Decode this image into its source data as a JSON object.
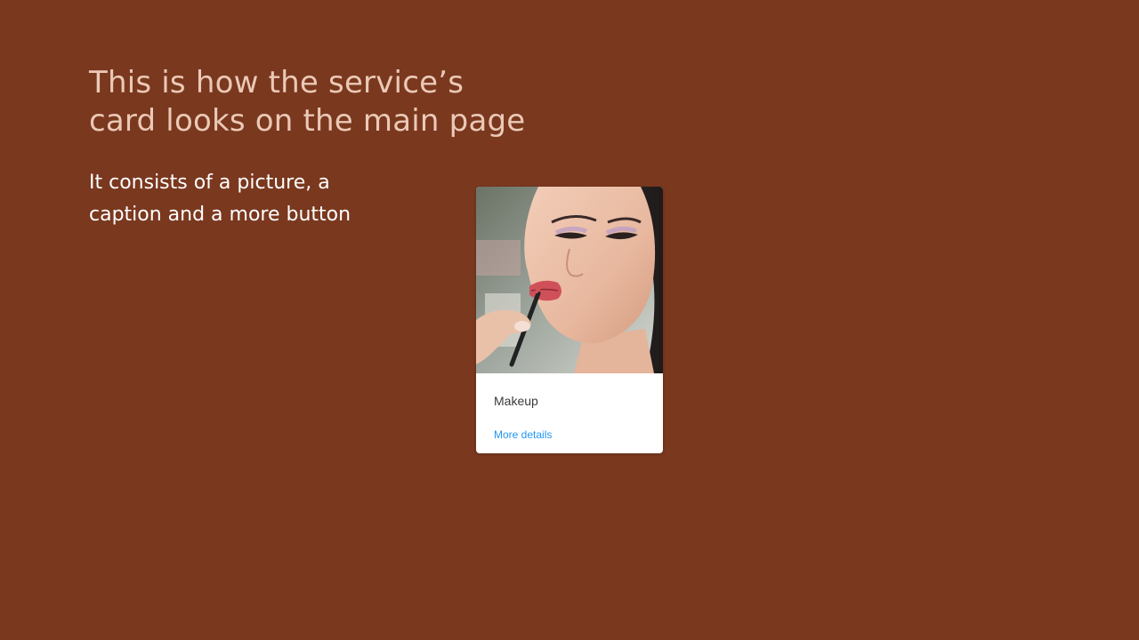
{
  "slide": {
    "title_lines": [
      "This is how the service’s",
      "card looks on the main page"
    ],
    "description_lines": [
      "It consists of a picture, a",
      "caption and a more button"
    ]
  },
  "card": {
    "image_subject": "makeup-photo",
    "caption": "Makeup",
    "link_label": "More details"
  },
  "colors": {
    "background": "#7a381f",
    "title": "#ebc9b6",
    "description": "#ffffff",
    "card": "#ffffff",
    "link": "#2196f3"
  }
}
